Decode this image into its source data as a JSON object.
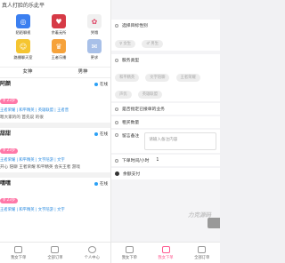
{
  "left": {
    "banner": "真人打脸的乐此平",
    "apps": [
      {
        "label": "陌陌聊视",
        "color": "#3b7ff0",
        "glyph": "◎",
        "icon": "chat-app-icon"
      },
      {
        "label": "余着无所",
        "color": "#d63a46",
        "glyph": "♥",
        "icon": "heart-app-icon"
      },
      {
        "label": "哭哦",
        "color": "#f0f0f0",
        "glyph": "✿",
        "icon": "flower-app-icon"
      },
      {
        "label": "路播聊天室",
        "color": "#f5c531",
        "glyph": "☺",
        "icon": "smile-app-icon"
      },
      {
        "label": "王者乐播",
        "color": "#f6a23a",
        "glyph": "♛",
        "icon": "crown-app-icon"
      },
      {
        "label": "更求",
        "color": "#a8c0e8",
        "glyph": "✉",
        "icon": "mail-app-icon"
      }
    ],
    "tabs": [
      "女神",
      "男神"
    ],
    "profiles": [
      {
        "name": "阿颜",
        "status": "在线",
        "badge": "♀ 23岁",
        "tags": "王者荣耀 | 和平精英 | 英雄联盟 | 王者营",
        "desc": "嗯大家的的 首先说 的很"
      },
      {
        "name": "甜甜",
        "status": "在线",
        "badge": "♀ 23岁",
        "tags": "王者荣耀 | 和平精英 | 文字陪游 | 文字",
        "desc": "开心 陪聊 王者荣耀 和平精英 会天王者 游戏"
      },
      {
        "name": "嘿嘿",
        "status": "在线",
        "badge": "♀ 23岁",
        "tags": "王者荣耀 | 和平精英 | 文字陪游 | 文字",
        "desc": ""
      }
    ],
    "nav": [
      {
        "label": "我女下单",
        "icon": "home-icon"
      },
      {
        "label": "全部订单",
        "icon": "list-icon"
      },
      {
        "label": "个人中心",
        "icon": "user-icon"
      }
    ]
  },
  "right": {
    "gender_label": "选择目标性别",
    "gender_options": [
      "♀ 女生",
      "♂ 男生"
    ],
    "service_label": "服务类型",
    "service_chips": [
      "和平精英",
      "文字陪聊",
      "王者荣耀",
      "声优",
      "英雄联盟"
    ],
    "assign_label": "是否指定已接单的业务",
    "duration_label": "租买数量",
    "remark_label": "留言备注",
    "remark_placeholder": "请输入备注内容",
    "duration_hours_label": "下单时间/小时",
    "duration_hours_value": "1",
    "agree_label": "余额支付",
    "watermark": "力克源码",
    "nav": [
      {
        "label": "我女下单",
        "icon": "home-icon"
      },
      {
        "label": "我女下单",
        "icon": "order-icon"
      },
      {
        "label": "全部订单",
        "icon": "list-icon"
      }
    ]
  }
}
